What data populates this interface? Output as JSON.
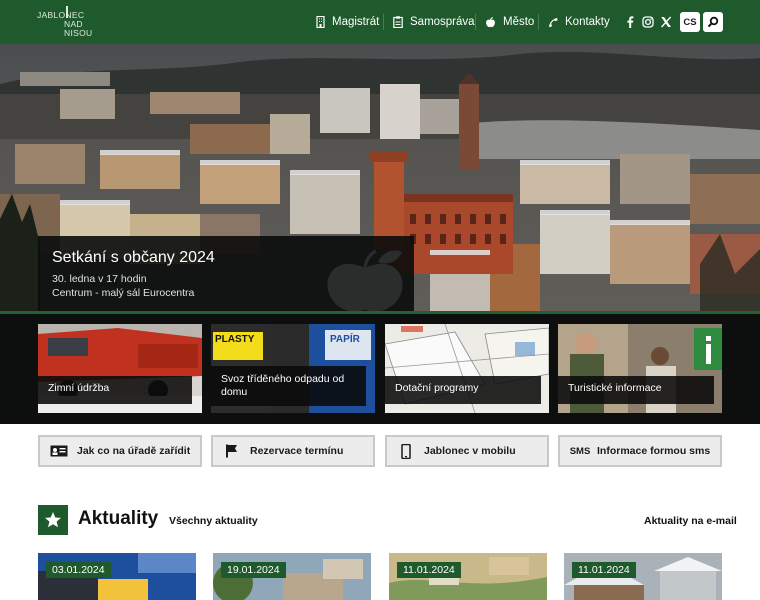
{
  "header": {
    "logo": {
      "line1": "JABLONEC",
      "line2": "NAD",
      "line3": "NISOU"
    },
    "nav": [
      "Magistrát",
      "Samospráva",
      "Město",
      "Kontakty"
    ],
    "social": [
      "facebook-icon",
      "instagram-icon",
      "x-icon"
    ],
    "lang": "CS"
  },
  "hero": {
    "title": "Setkání s občany 2024",
    "line1": "30. ledna v 17 hodin",
    "line2": "Centrum - malý sál Eurocentra"
  },
  "tiles": [
    {
      "label": "Zimní údržba"
    },
    {
      "label": "Svoz tříděného odpadu od domu",
      "sign1": "PLASTY",
      "sign2": "PAPÍR"
    },
    {
      "label": "Dotační programy"
    },
    {
      "label": "Turistické informace"
    }
  ],
  "quick": [
    {
      "label": "Jak co na úřadě zařídit"
    },
    {
      "label": "Rezervace termínu"
    },
    {
      "label": "Jablonec v mobilu"
    },
    {
      "label": "Informace formou sms",
      "icon_text": "SMS"
    }
  ],
  "aktuality": {
    "title": "Aktuality",
    "all": "Všechny aktuality",
    "email": "Aktuality na e-mail"
  },
  "news": [
    {
      "date": "03.01.2024"
    },
    {
      "date": "19.01.2024"
    },
    {
      "date": "11.01.2024"
    },
    {
      "date": "11.01.2024"
    }
  ],
  "colors": {
    "brand_green": "#1f5a2c",
    "tile_band": "#0d0f0e"
  }
}
